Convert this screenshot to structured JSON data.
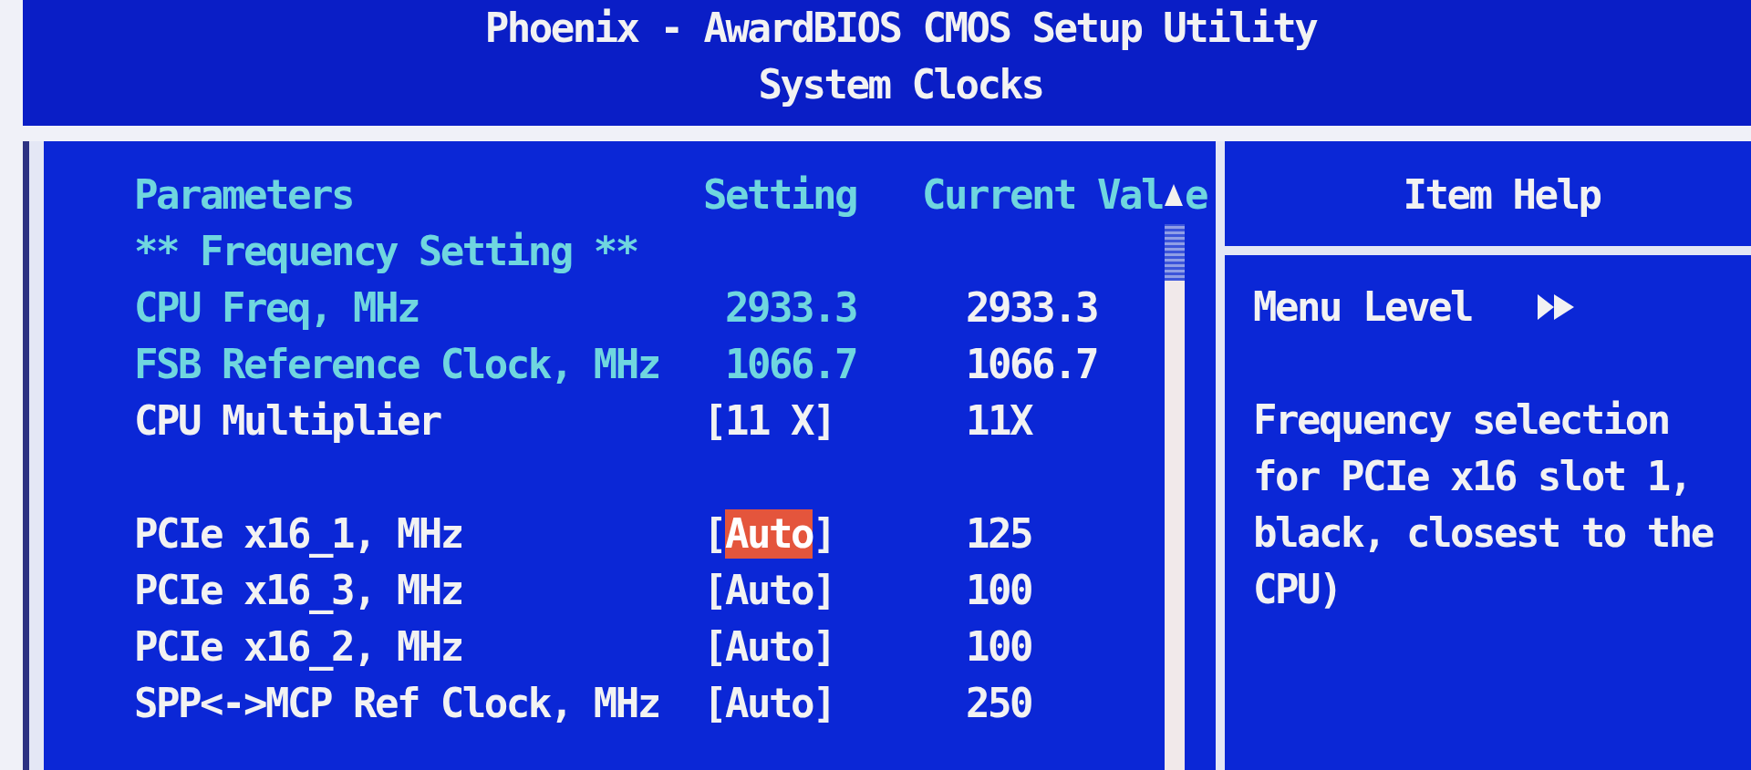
{
  "header": {
    "title": "Phoenix - AwardBIOS CMOS Setup Utility",
    "subtitle": "System Clocks"
  },
  "settings": {
    "columns": [
      {
        "label": "Parameters"
      },
      {
        "label": "Setting"
      },
      {
        "label": "Current Val",
        "after_scroll_arrow": "e"
      }
    ],
    "items": [
      {
        "kind": "section",
        "label": "** Frequency Setting **"
      },
      {
        "kind": "readonly",
        "label": "CPU Freq, MHz",
        "setting": "2933.3",
        "current": "2933.3"
      },
      {
        "kind": "readonly",
        "label": "FSB Reference Clock, MHz",
        "setting": "1066.7",
        "current": "1066.7"
      },
      {
        "kind": "option",
        "label": "CPU Multiplier",
        "open": "[",
        "setting": "11 X",
        "close": "]",
        "current": "11X",
        "selected": false
      },
      {
        "kind": "gap"
      },
      {
        "kind": "option",
        "label": "PCIe x16_1, MHz",
        "open": "[",
        "setting": "Auto",
        "close": "]",
        "current": "125",
        "selected": true
      },
      {
        "kind": "option",
        "label": "PCIe x16_3, MHz",
        "open": "[",
        "setting": "Auto",
        "close": "]",
        "current": "100",
        "selected": false
      },
      {
        "kind": "option",
        "label": "PCIe x16_2, MHz",
        "open": "[",
        "setting": "Auto",
        "close": "]",
        "current": "100",
        "selected": false
      },
      {
        "kind": "option",
        "label": "SPP<->MCP Ref Clock, MHz",
        "open": "[",
        "setting": "Auto",
        "close": "]",
        "current": "250",
        "selected": false
      }
    ]
  },
  "help": {
    "title": "Item Help",
    "menu_level": "Menu Level",
    "text": "Frequency selection for PCIe x16 slot 1, black, closest to the CPU)"
  }
}
